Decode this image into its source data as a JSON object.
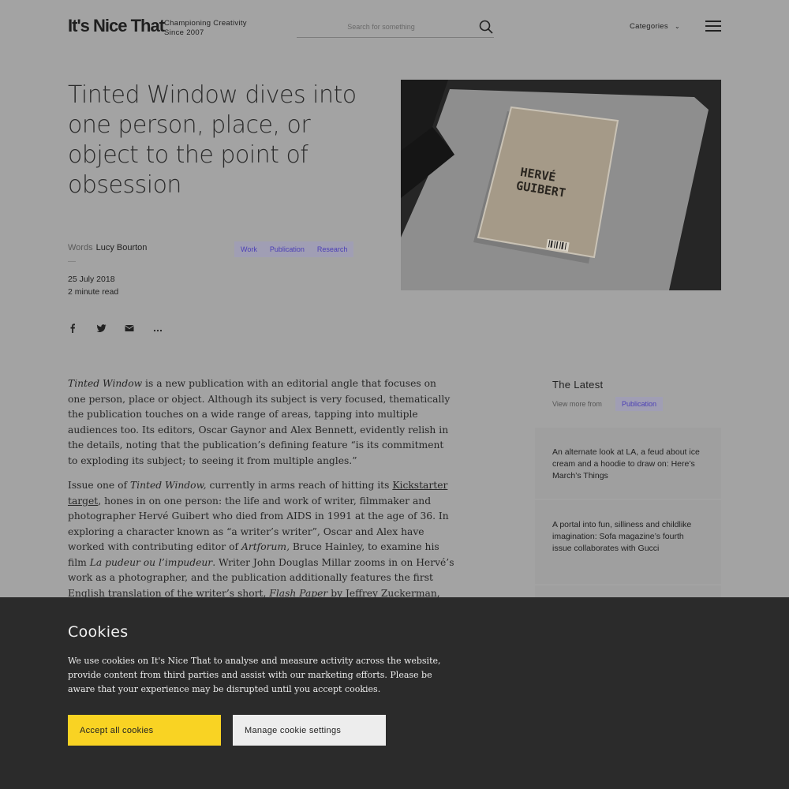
{
  "header": {
    "logo": "It's Nice That",
    "tagline_line1": "Championing Creativity",
    "tagline_line2": "Since 2007",
    "search_placeholder": "Search for something",
    "categories_label": "Categories",
    "search_icon": "search-icon",
    "menu_icon": "hamburger-menu-icon"
  },
  "article": {
    "title": "Tinted Window dives into one person, place, or object to the point of obsession",
    "words_label": "Words",
    "author": "Lucy Bourton",
    "dash": "—",
    "date": "25 July 2018",
    "read_time": "2 minute read",
    "tags": [
      "Work",
      "Publication",
      "Research"
    ],
    "hero_image_text_line1": "HERVÉ",
    "hero_image_text_line2": "GUIBERT",
    "share_icons": [
      "facebook-icon",
      "twitter-icon",
      "email-icon",
      "more-icon"
    ],
    "p1_italic": "Tinted Window",
    "p1_rest": " is a new publication with an editorial angle that focuses on one person, place or object. Although its subject is very focused, thematically the publication touches on a wide range of areas, tapping into multiple audiences too. Its editors, Oscar Gaynor and Alex Bennett, evidently relish in the details, noting that the publication’s defining feature “is its commitment to exploding its subject; to seeing it from multiple angles.”",
    "p2_a": "Issue one of ",
    "p2_italic1": "Tinted Window,",
    "p2_b": " currently in arms reach of hitting its ",
    "p2_link": "Kickstarter target",
    "p2_c": ", hones in on one person: the life and work of writer, filmmaker and photographer Hervé Guibert who died from AIDS in 1991 at the age of 36. In exploring a character known as “a writer’s writer”, Oscar and Alex have worked with contributing editor of ",
    "p2_italic2": "Artforum,",
    "p2_d": " Bruce Hainley, to examine his film ",
    "p2_italic3": "La pudeur ou l’impudeur",
    "p2_e": ". Writer John Douglas Millar zooms in on Hervé’s work as a photographer, and the publication additionally features the first English translation of the writer’s short, ",
    "p2_italic4": "Flash Paper",
    "p2_f": " by Jeffrey Zuckerman, sitting next to"
  },
  "sidebar": {
    "title": "The Latest",
    "view_more": "View more from",
    "view_more_tag": "Publication",
    "cards": [
      "An alternate look at LA, a feud about ice cream and a hoodie to draw on: Here’s March’s Things",
      "A portal into fun, silliness and childlike imagination: Sofa magazine’s fourth issue collaborates with Gucci"
    ]
  },
  "cookie": {
    "title": "Cookies",
    "text": "We use cookies on It's Nice That to analyse and measure activity across the website, provide content from third parties and assist with our marketing efforts. Please be aware that your experience may be disrupted until you accept cookies.",
    "accept_label": "Accept all cookies",
    "manage_label": "Manage cookie settings",
    "accent_color": "#f9d323"
  }
}
